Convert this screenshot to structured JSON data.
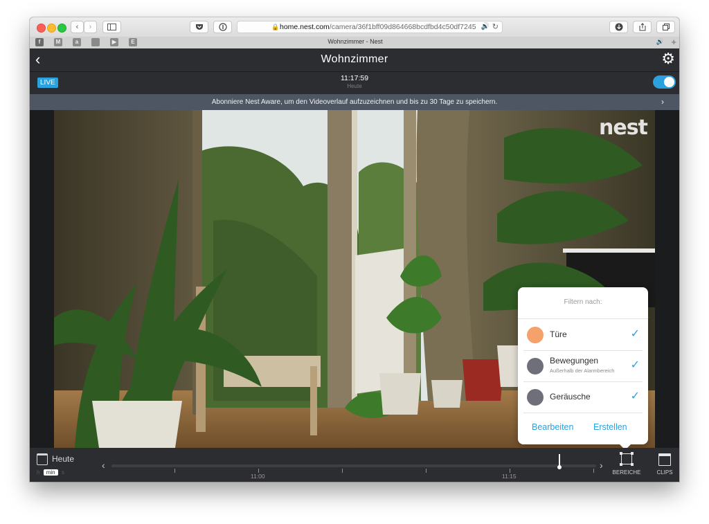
{
  "browser": {
    "url_host": "home.nest.com",
    "url_path": "/camera/36f1bff09d864668bcdfbd4c50df7245",
    "tab_title": "Wohnzimmer - Nest",
    "favicons": [
      "f",
      "M",
      "a",
      "",
      "▶",
      "E"
    ]
  },
  "header": {
    "title": "Wohnzimmer"
  },
  "status": {
    "live_label": "LIVE",
    "time": "11:17:59",
    "date": "Heute"
  },
  "banner": {
    "text": "Abonniere Nest Aware, um den Videoverlauf aufzuzeichnen und bis zu 30 Tage zu speichern."
  },
  "video": {
    "logo": "nest"
  },
  "filter": {
    "title": "Filtern nach:",
    "items": [
      {
        "label": "Türe",
        "sub": "",
        "color": "#f5a16b",
        "checked": true
      },
      {
        "label": "Bewegungen",
        "sub": "Außerhalb der Alarmbereich",
        "color": "#6e6f78",
        "checked": true
      },
      {
        "label": "Geräusche",
        "sub": "",
        "color": "#6e6f78",
        "checked": true
      }
    ],
    "edit_label": "Bearbeiten",
    "create_label": "Erstellen"
  },
  "timeline": {
    "today_label": "Heute",
    "zoom_left": "h",
    "zoom_active": "min",
    "zoom_right": "s",
    "labels": [
      "11:00",
      "11:15"
    ],
    "areas_label": "BEREICHE",
    "clips_label": "CLIPS"
  },
  "colors": {
    "accent": "#2ba1dd",
    "banner": "#4d5662",
    "app_bg": "#2b2d30"
  }
}
